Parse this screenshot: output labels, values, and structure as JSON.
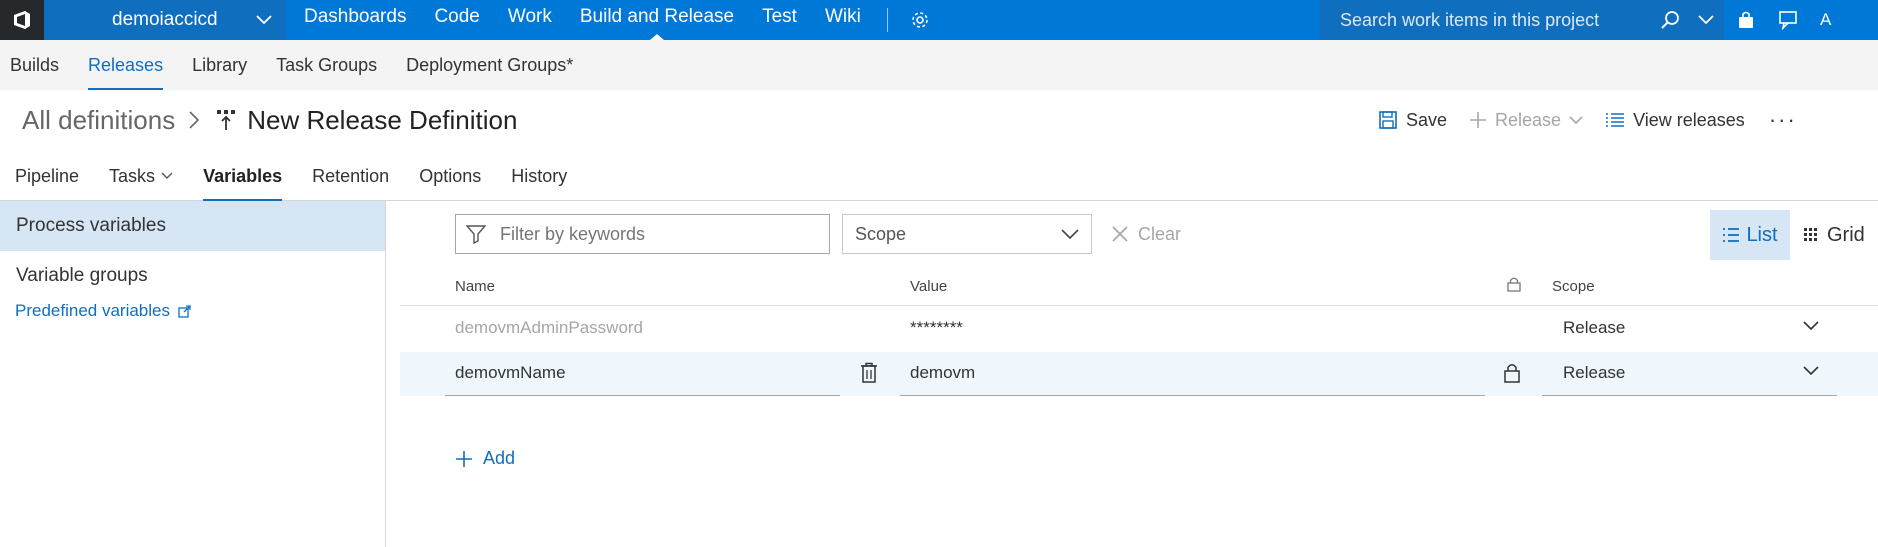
{
  "topnav": {
    "project": "demoiaccicd",
    "items": [
      "Dashboards",
      "Code",
      "Work",
      "Build and Release",
      "Test",
      "Wiki"
    ],
    "active_item": "Build and Release",
    "search_placeholder": "Search work items in this project",
    "avatar_initial": "A"
  },
  "subnav": {
    "items": [
      "Builds",
      "Releases",
      "Library",
      "Task Groups",
      "Deployment Groups*"
    ],
    "active_item": "Releases"
  },
  "header": {
    "breadcrumb": "All definitions",
    "title": "New Release Definition",
    "save_label": "Save",
    "release_label": "Release",
    "view_releases_label": "View releases",
    "more_label": "···"
  },
  "tabs": {
    "items": [
      "Pipeline",
      "Tasks",
      "Variables",
      "Retention",
      "Options",
      "History"
    ],
    "active": "Variables"
  },
  "leftpane": {
    "process_variables": "Process variables",
    "variable_groups": "Variable groups",
    "predefined_variables": "Predefined variables"
  },
  "toolbar": {
    "filter_placeholder": "Filter by keywords",
    "scope_label": "Scope",
    "clear_label": "Clear",
    "list_label": "List",
    "grid_label": "Grid"
  },
  "table": {
    "columns": {
      "name": "Name",
      "value": "Value",
      "scope": "Scope"
    },
    "rows": [
      {
        "name": "demovmAdminPassword",
        "value": "********",
        "scope": "Release",
        "secret": true
      },
      {
        "name": "demovmName",
        "value": "demovm",
        "scope": "Release",
        "secret": false
      }
    ]
  },
  "add_label": "Add",
  "colors": {
    "accent": "#0078d7",
    "accent_dark": "#106ebe",
    "selected_bg": "#d6e6f5"
  }
}
